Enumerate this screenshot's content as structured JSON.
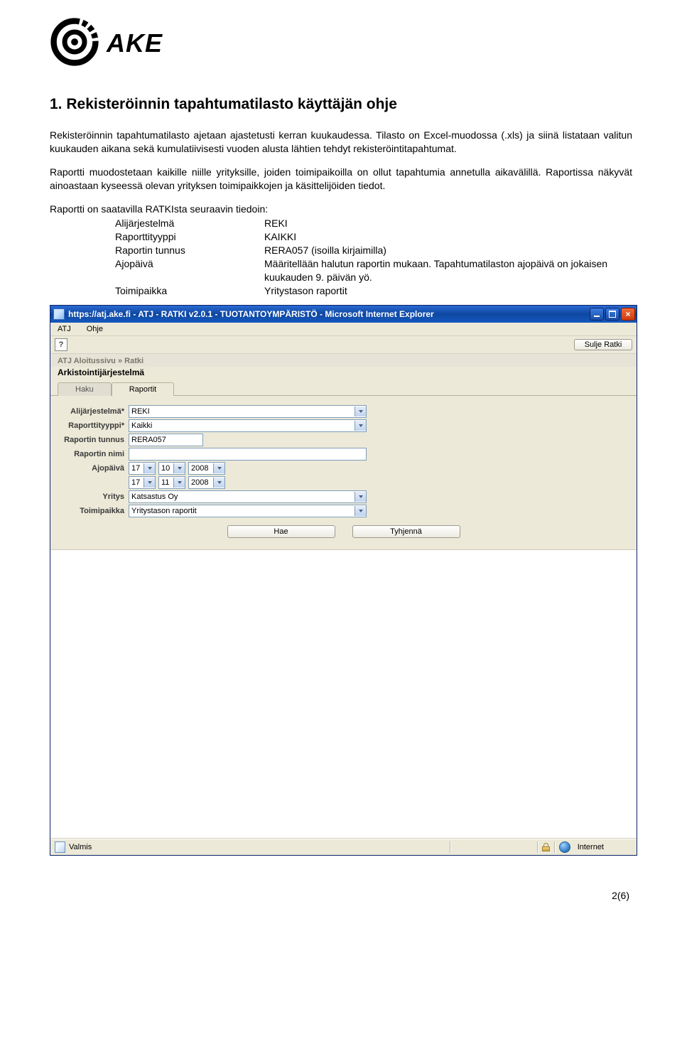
{
  "logo_text": "AKE",
  "heading": "1. Rekisteröinnin tapahtumatilasto käyttäjän ohje",
  "para1": "Rekisteröinnin tapahtumatilasto ajetaan ajastetusti kerran kuukaudessa. Tilasto on Excel-muodossa (.xls) ja siinä listataan valitun kuukauden aikana sekä kumulatiivisesti vuoden alusta lähtien tehdyt rekisteröintitapahtumat.",
  "para2": "Raportti muodostetaan kaikille niille yrityksille, joiden toimipaikoilla on ollut tapahtumia annetulla aikavälillä. Raportissa näkyvät ainoastaan kyseessä olevan yrityksen toimipaikkojen ja käsittelijöiden tiedot.",
  "para3_lead": "Raportti on saatavilla RATKIsta seuraavin tiedoin:",
  "rows": [
    {
      "label": "Alijärjestelmä",
      "value": "REKI"
    },
    {
      "label": "Raporttityyppi",
      "value": "KAIKKI"
    },
    {
      "label": "Raportin tunnus",
      "value": "RERA057 (isoilla kirjaimilla)"
    },
    {
      "label": "Ajopäivä",
      "value": "Määritellään halutun raportin mukaan. Tapahtumatilaston ajopäivä on jokaisen kuukauden 9. päivän yö."
    },
    {
      "label": "Toimipaikka",
      "value": "Yritystason raportit"
    }
  ],
  "shot": {
    "title": "https://atj.ake.fi - ATJ - RATKI v2.0.1 - TUOTANTOYMPÄRISTÖ - Microsoft Internet Explorer",
    "menu": {
      "atj": "ATJ",
      "ohje": "Ohje"
    },
    "help_char": "?",
    "close_ratki": "Sulje Ratki",
    "breadcrumb": "ATJ Aloitussivu » Ratki",
    "system_title": "Arkistointijärjestelmä",
    "tabs": {
      "haku": "Haku",
      "raportit": "Raportit"
    },
    "form": {
      "alijarjestelma": {
        "label": "Alijärjestelmä*",
        "value": "REKI"
      },
      "raporttityyppi": {
        "label": "Raporttityyppi*",
        "value": "Kaikki"
      },
      "raportin_tunnus": {
        "label": "Raportin tunnus",
        "value": "RERA057"
      },
      "raportin_nimi": {
        "label": "Raportin nimi",
        "value": ""
      },
      "ajopaiva": {
        "label": "Ajopäivä",
        "d1": "17",
        "m1": "10",
        "y1": "2008",
        "d2": "17",
        "m2": "11",
        "y2": "2008"
      },
      "yritys": {
        "label": "Yritys",
        "value": "Katsastus Oy"
      },
      "toimipaikka": {
        "label": "Toimipaikka",
        "value": "Yritystason raportit"
      }
    },
    "buttons": {
      "hae": "Hae",
      "tyhjenna": "Tyhjennä"
    },
    "status": {
      "left": "Valmis",
      "zone": "Internet"
    }
  },
  "pagenum": "2(6)"
}
